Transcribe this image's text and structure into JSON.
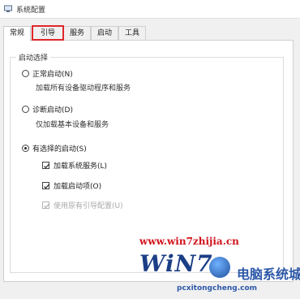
{
  "window": {
    "title": "系统配置"
  },
  "tabs": [
    {
      "label": "常规",
      "active": true
    },
    {
      "label": "引导",
      "active": false,
      "highlighted": true
    },
    {
      "label": "服务",
      "active": false
    },
    {
      "label": "启动",
      "active": false
    },
    {
      "label": "工具",
      "active": false
    }
  ],
  "startup_selection": {
    "group_label": "启动选择",
    "options": [
      {
        "label": "正常启动(N)",
        "description": "加载所有设备驱动程序和服务",
        "checked": false
      },
      {
        "label": "诊断启动(D)",
        "description": "仅加载基本设备和服务",
        "checked": false
      },
      {
        "label": "有选择的启动(S)",
        "checked": true
      }
    ],
    "sub_options": [
      {
        "label": "加载系统服务(L)",
        "checked": true,
        "enabled": true
      },
      {
        "label": "加载启动项(O)",
        "checked": true,
        "enabled": true
      },
      {
        "label": "使用原有引导配置(U)",
        "checked": true,
        "enabled": false
      }
    ]
  },
  "watermark": {
    "url": "www.win7zhijia.cn",
    "logo_text": "WiN7",
    "site_name": "电脑系统城",
    "site_url": "pcxitongcheng.com"
  },
  "colors": {
    "highlight": "#e0272b",
    "watermark_red": "#d0121a",
    "watermark_blue": "#1b3e86"
  }
}
